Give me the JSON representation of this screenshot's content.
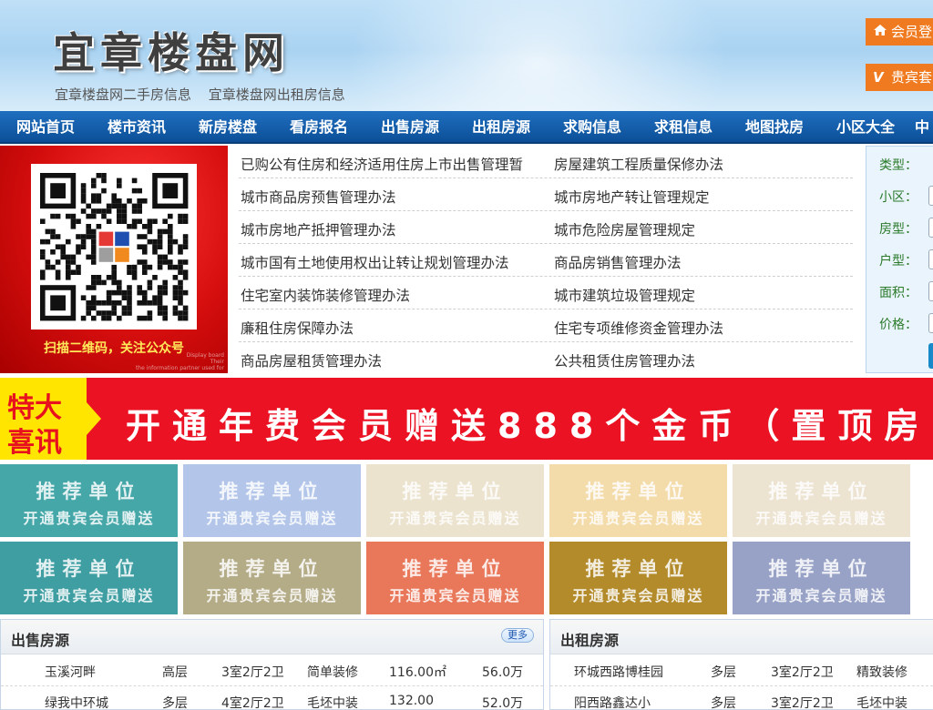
{
  "header": {
    "site_title": "宜章楼盘网",
    "sub_links": [
      "宜章楼盘网二手房信息",
      "宜章楼盘网出租房信息"
    ],
    "login_label": "会员登",
    "vip_label": "贵宾套",
    "vip_badge": "V"
  },
  "nav": {
    "items": [
      "网站首页",
      "楼市资讯",
      "新房楼盘",
      "看房报名",
      "出售房源",
      "出租房源",
      "求购信息",
      "求租信息",
      "地图找房",
      "小区大全",
      "中"
    ]
  },
  "qr": {
    "caption": "扫描二维码，关注公众号",
    "fine_print": [
      "Display board",
      "Their",
      "the information partner used for"
    ]
  },
  "news": {
    "left": [
      "已购公有住房和经济适用住房上市出售管理暂",
      "城市商品房预售管理办法",
      "城市房地产抵押管理办法",
      "城市国有土地使用权出让转让规划管理办法",
      "住宅室内装饰装修管理办法",
      "廉租住房保障办法",
      "商品房屋租赁管理办法"
    ],
    "right": [
      "房屋建筑工程质量保修办法",
      "城市房地产转让管理规定",
      "城市危险房屋管理规定",
      "商品房销售管理办法",
      "城市建筑垃圾管理规定",
      "住宅专项维修资金管理办法",
      "公共租赁住房管理办法"
    ]
  },
  "search": {
    "labels": [
      "类型：",
      "小区：",
      "房型：",
      "户型：",
      "面积：",
      "价格："
    ]
  },
  "banner": {
    "flag_line1": "特大",
    "flag_line2": "喜讯",
    "text": "开通年费会员赠送888个金币（置顶房"
  },
  "ads": {
    "line1": "推荐单位",
    "line2": "开通贵宾会员赠送",
    "colors": [
      "#45a7a8",
      "#b3c6ea",
      "#ece3cf",
      "#f3dca9",
      "#ede3d1",
      "#3e9ea2",
      "#b4ab87",
      "#e9785b",
      "#b38b2a",
      "#98a2c6"
    ],
    "text_colors": [
      "#ffffff",
      "#ffffff",
      "#ffffff",
      "#ffffff",
      "#ffffff",
      "#ffffff",
      "#ffffff",
      "#ffffff",
      "#ffffff",
      "#ffffff"
    ]
  },
  "sale": {
    "title": "出售房源",
    "more": "更多",
    "rows": [
      {
        "name": "玉溪河畔",
        "type": "高层",
        "layout": "3室2厅2卫",
        "deco": "简单装修",
        "area": "116.00㎡",
        "price": "56.0万"
      },
      {
        "name": "绿我中环城",
        "type": "多层",
        "layout": "4室2厅2卫",
        "deco": "毛坯中装",
        "area": "132.00",
        "price": "52.0万"
      }
    ]
  },
  "rent": {
    "title": "出租房源",
    "rows": [
      {
        "name": "环城西路博桂园",
        "type": "多层",
        "layout": "3室2厅2卫",
        "deco": "精致装修"
      },
      {
        "name": "阳西路鑫达小",
        "type": "多层",
        "layout": "3室2厅2卫",
        "deco": "毛坯中装"
      }
    ]
  }
}
